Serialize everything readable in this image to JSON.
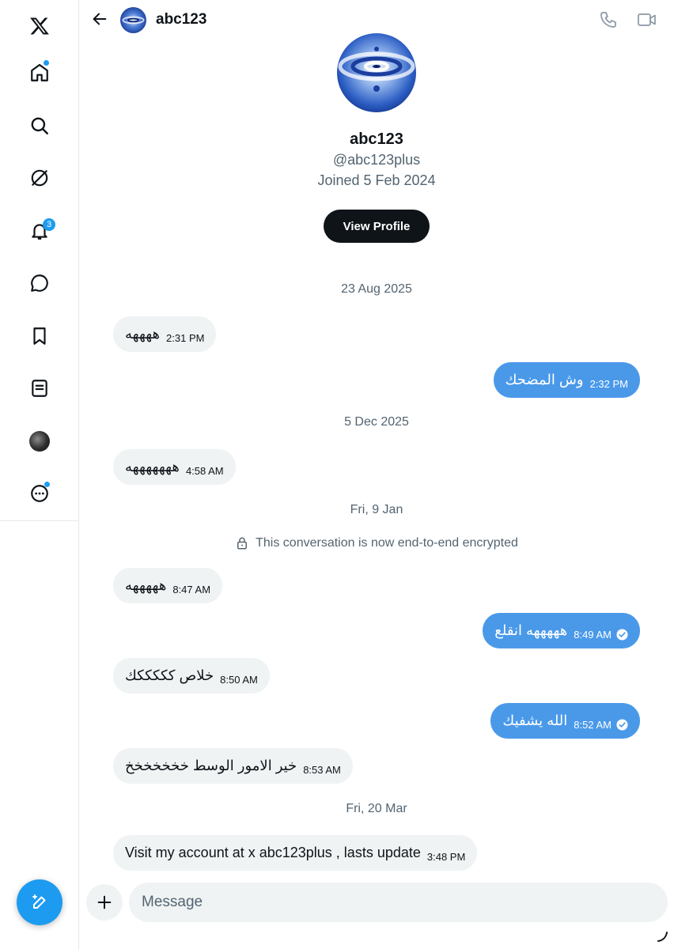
{
  "header": {
    "title": "abc123",
    "back_icon": "arrow-left-icon",
    "call_icon": "phone-icon",
    "video_icon": "video-icon"
  },
  "sidebar": {
    "items": [
      {
        "name": "x-logo",
        "icon": "x-logo-icon"
      },
      {
        "name": "home",
        "icon": "home-icon",
        "dot": true
      },
      {
        "name": "explore",
        "icon": "search-icon"
      },
      {
        "name": "grok",
        "icon": "grok-icon"
      },
      {
        "name": "notifications",
        "icon": "bell-icon",
        "badge": "3"
      },
      {
        "name": "messages",
        "icon": "message-icon"
      },
      {
        "name": "bookmarks",
        "icon": "bookmark-icon"
      },
      {
        "name": "lists",
        "icon": "list-icon"
      },
      {
        "name": "profile",
        "icon": "avatar"
      },
      {
        "name": "more",
        "icon": "more-icon",
        "dot": true
      }
    ],
    "compose_icon": "compose-icon",
    "notifications_badge": "3"
  },
  "profile": {
    "name": "abc123",
    "handle": "@abc123plus",
    "joined": "Joined 5 Feb 2024",
    "view_button": "View Profile"
  },
  "conversation": {
    "dates": [
      "23 Aug 2025",
      "5 Dec 2025",
      "Fri, 9 Jan",
      "Fri, 20 Mar"
    ],
    "encryption_notice": "This conversation is now end-to-end encrypted",
    "messages": [
      {
        "dir": "in",
        "text": "ههههه",
        "time": "2:31 PM"
      },
      {
        "dir": "out",
        "text": "وش المضحك",
        "time": "2:32 PM"
      },
      {
        "dir": "in",
        "text": "هههههههه",
        "time": "4:58 AM"
      },
      {
        "dir": "in",
        "text": "هههههه",
        "time": "8:47 AM"
      },
      {
        "dir": "out",
        "text": "هههههه انقلع",
        "time": "8:49 AM",
        "read": true
      },
      {
        "dir": "in",
        "text": "خلاص كككككك",
        "time": "8:50 AM"
      },
      {
        "dir": "out",
        "text": "الله يشفيك",
        "time": "8:52 AM",
        "read": true
      },
      {
        "dir": "in",
        "text": "خير الامور الوسط خخخخخخخ",
        "time": "8:53 AM"
      },
      {
        "dir": "in",
        "text": "Visit my account at x abc123plus , lasts update",
        "time": "3:48 PM"
      }
    ]
  },
  "composer": {
    "placeholder": "Message",
    "plus_icon": "plus-icon"
  },
  "colors": {
    "accent": "#1d9bf0",
    "outgoing_bubble": "#4a99e9",
    "incoming_bubble": "#eff3f4",
    "muted_text": "#536471"
  }
}
